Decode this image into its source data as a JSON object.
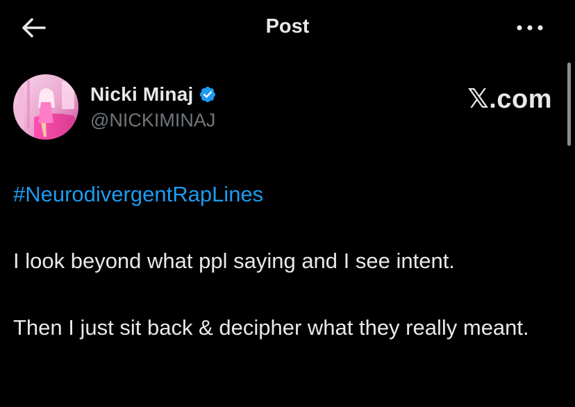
{
  "header": {
    "title": "Post",
    "back_icon": "arrow-left-icon",
    "more_icon": "more-horizontal-icon"
  },
  "author": {
    "display_name": "Nicki Minaj",
    "handle": "@NICKIMINAJ",
    "verified": true,
    "verified_color": "#1d9bf0"
  },
  "watermark": "𝕏.com",
  "post": {
    "hashtag": "#NeurodivergentRapLines",
    "line1": "I look beyond what ppl saying and I see intent.",
    "line2": "Then I just sit back & decipher what they really meant."
  },
  "colors": {
    "background": "#000000",
    "text": "#e7e9ea",
    "secondary": "#71767b",
    "accent": "#1d9bf0"
  }
}
